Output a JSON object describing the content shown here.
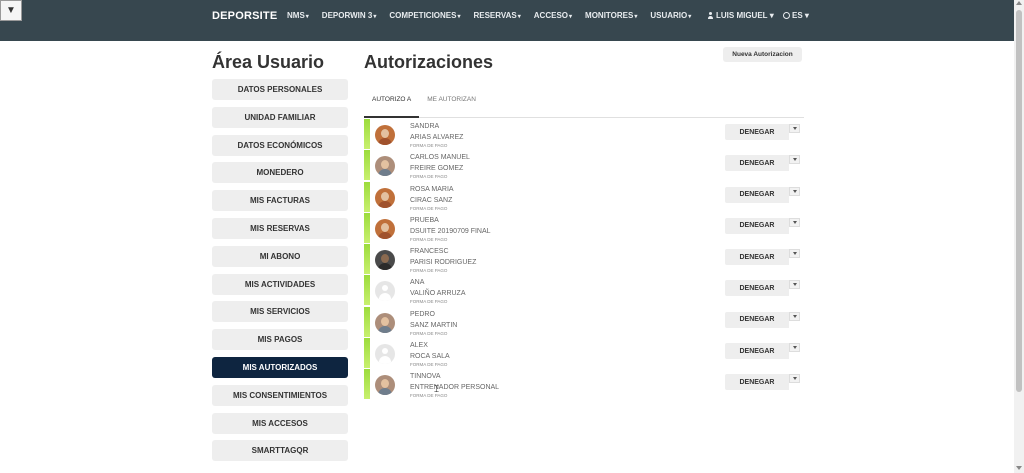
{
  "topbar": {
    "toggle_icon": "▼",
    "brand": "DEPORSITE",
    "menu": [
      "NMS",
      "DEPORWIN 3",
      "COMPETICIONES",
      "RESERVAS",
      "ACCESO",
      "MONITORES",
      "USUARIO"
    ],
    "user": "LUIS MIGUEL",
    "lang": "ES",
    "background_color": "#37474f"
  },
  "sidebar": {
    "title": "Área Usuario",
    "items": [
      {
        "label": "DATOS PERSONALES",
        "active": false
      },
      {
        "label": "UNIDAD FAMILIAR",
        "active": false
      },
      {
        "label": "DATOS ECONÓMICOS",
        "active": false
      },
      {
        "label": "MONEDERO",
        "active": false
      },
      {
        "label": "MIS FACTURAS",
        "active": false
      },
      {
        "label": "MIS RESERVAS",
        "active": false
      },
      {
        "label": "MI ABONO",
        "active": false
      },
      {
        "label": "MIS ACTIVIDADES",
        "active": false
      },
      {
        "label": "MIS SERVICIOS",
        "active": false
      },
      {
        "label": "MIS PAGOS",
        "active": false
      },
      {
        "label": "MIS AUTORIZADOS",
        "active": true
      },
      {
        "label": "MIS CONSENTIMIENTOS",
        "active": false
      },
      {
        "label": "MIS ACCESOS",
        "active": false
      },
      {
        "label": "SMARTTAGQR",
        "active": false
      }
    ],
    "active_color": "#0e2540"
  },
  "main": {
    "title": "Autorizaciones",
    "new_button": "Nueva Autorizacion",
    "tabs": [
      {
        "label": "AUTORIZO A",
        "active": true
      },
      {
        "label": "ME AUTORIZAN",
        "active": false
      }
    ],
    "accent_color": "#9cdc3c",
    "pay_label": "FORMA DE PAGO",
    "deny_label": "DENEGAR",
    "authorizations": [
      {
        "first": "SANDRA",
        "last": "ARIAS ALVAREZ",
        "avatar": "photo warm"
      },
      {
        "first": "CARLOS MANUEL",
        "last": "FREIRE GOMEZ",
        "avatar": "photo light"
      },
      {
        "first": "ROSA MARIA",
        "last": "CIRAC SANZ",
        "avatar": "photo warm"
      },
      {
        "first": "PRUEBA",
        "last": "DSUITE 20190709 FINAL",
        "avatar": "photo warm"
      },
      {
        "first": "FRANCESC",
        "last": "PARISI RODRIGUEZ",
        "avatar": "photo dark"
      },
      {
        "first": "ANA",
        "last": "VALIÑO ARRUZA",
        "avatar": "placeholder"
      },
      {
        "first": "PEDRO",
        "last": "SANZ MARTIN",
        "avatar": "photo light"
      },
      {
        "first": "ALEX",
        "last": "ROCA SALA",
        "avatar": "placeholder"
      },
      {
        "first": "TINNOVA",
        "last": "ENTRENADOR PERSONAL",
        "avatar": "photo light"
      }
    ]
  }
}
